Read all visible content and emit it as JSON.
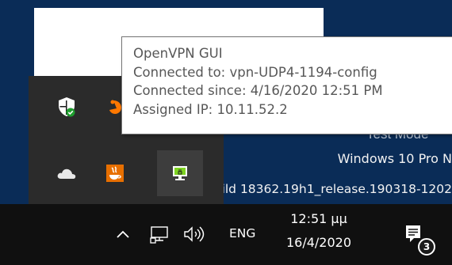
{
  "desktop": {
    "watermark_test_mode": "Test Mode",
    "watermark_edition": "Windows 10 Pro N",
    "watermark_build": "Build 18362.19h1_release.190318-1202"
  },
  "overflow": {
    "icons": [
      "windows-security-icon",
      "avast-icon",
      "onedrive-icon",
      "java-update-icon",
      "openvpn-icon"
    ]
  },
  "tooltip": {
    "app_name": "OpenVPN GUI",
    "connected_to": "Connected to: vpn-UDP4-1194-config",
    "connected_since": "Connected since: 4/16/2020 12:51 PM",
    "assigned_ip": "Assigned IP: 10.11.52.2"
  },
  "taskbar": {
    "language": "ENG",
    "clock_time": "12:51 μμ",
    "clock_date": "16/4/2020",
    "notification_count": "3"
  },
  "colors": {
    "taskbar_bg": "#101010",
    "desktop_bg": "#0a2c57",
    "tooltip_text": "#575757",
    "security_green": "#1e9e2e",
    "java_orange": "#e76f00",
    "vpn_screen_green": "#7ed321"
  }
}
